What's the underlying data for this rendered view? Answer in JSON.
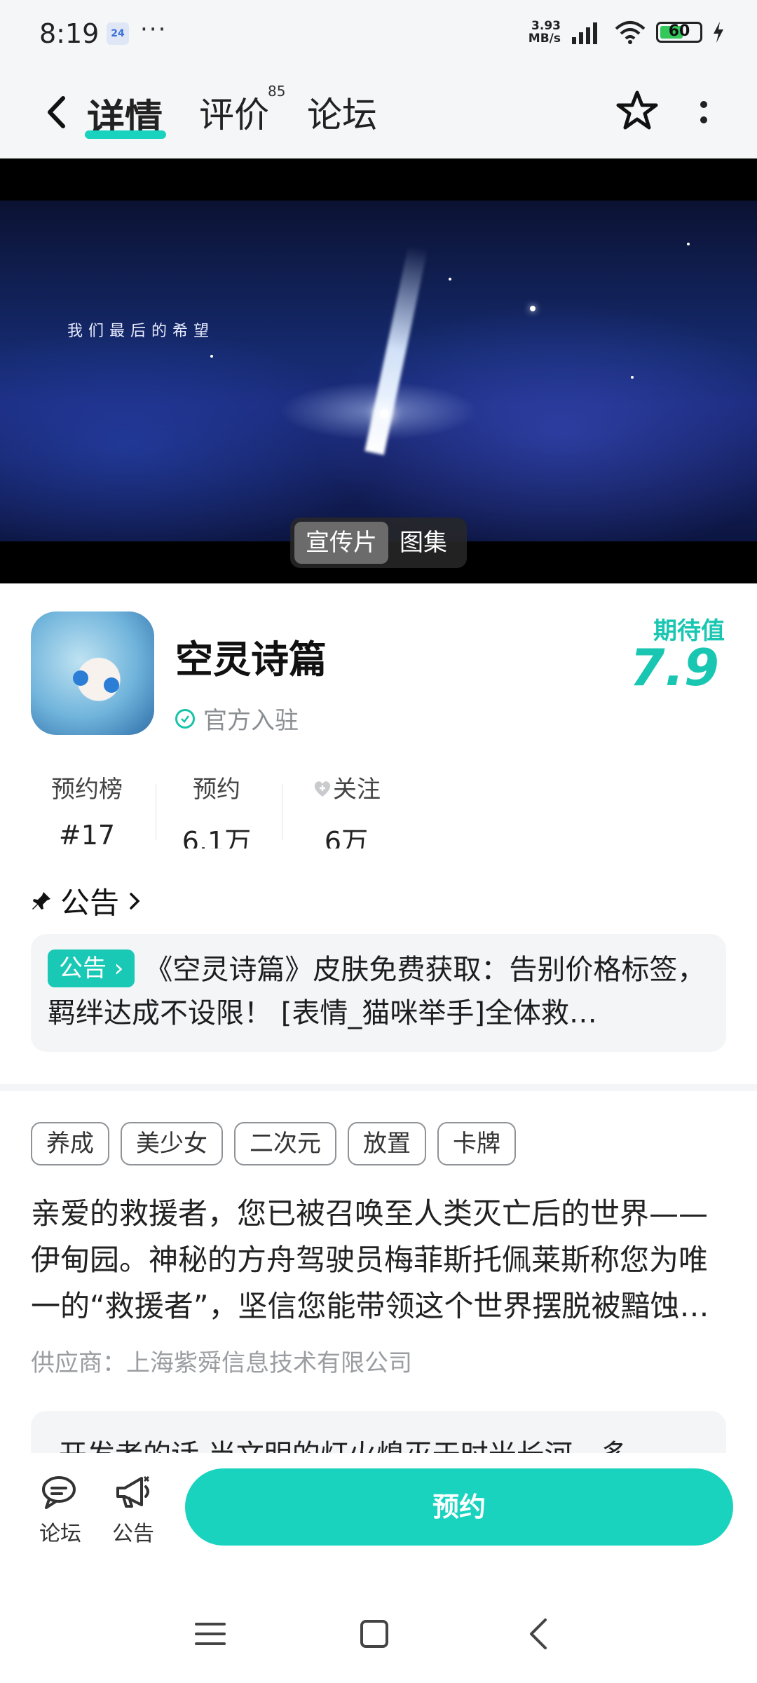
{
  "status": {
    "time": "8:19",
    "notif_badge": "24",
    "dots": "···",
    "net_speed_value": "3.93",
    "net_speed_unit": "MB/s",
    "battery": "60"
  },
  "header": {
    "tabs": [
      {
        "label": "详情",
        "active": true
      },
      {
        "label": "评价",
        "badge": "85"
      },
      {
        "label": "论坛"
      }
    ]
  },
  "hero": {
    "caption": "我们最后的希望",
    "media_options": [
      "宣传片",
      "图集"
    ],
    "selected": "宣传片"
  },
  "game": {
    "title": "空灵诗篇",
    "official_label": "官方入驻",
    "score_label": "期待值",
    "score": "7.9"
  },
  "stats": [
    {
      "label": "预约榜",
      "value": "#17"
    },
    {
      "label": "预约",
      "value": "6.1万"
    },
    {
      "label": "关注",
      "value": "6万"
    }
  ],
  "notice": {
    "heading": "公告",
    "tag": "公告",
    "text": "《空灵诗篇》皮肤免费获取：告别价格标签，羁绊达成不设限！ [表情_猫咪举手]全体救…"
  },
  "tags": [
    "养成",
    "美少女",
    "二次元",
    "放置",
    "卡牌"
  ],
  "description": "亲爱的救援者，您已被召唤至人类灭亡后的世界——伊甸园。神秘的方舟驾驶员梅菲斯托佩莱斯称您为唯一的“救援者”，坚信您能带领这个世界摆脱被黯蚀…",
  "supplier": "供应商：上海紫舜信息技术有限公司",
  "developer_note": "开发者的话 当文明的灯火熄灭于时光长河，多",
  "bottom": {
    "forum_label": "论坛",
    "notice_label": "公告",
    "reserve_label": "预约"
  },
  "colors": {
    "accent": "#19d3bf",
    "score": "#19c6b2"
  }
}
